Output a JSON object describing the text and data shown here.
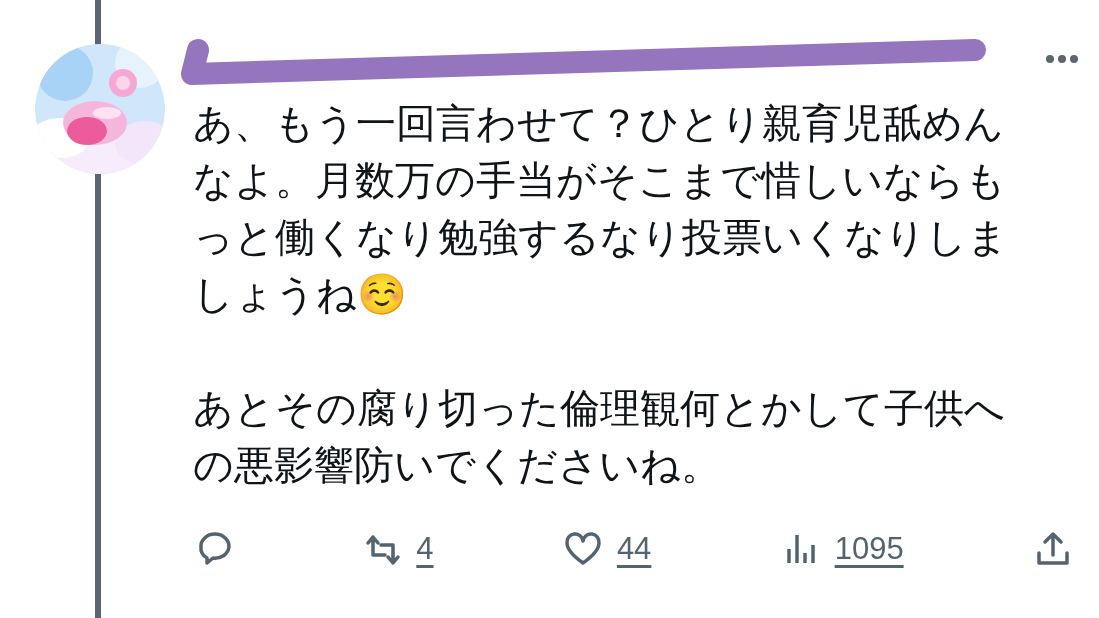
{
  "post": {
    "body": [
      "あ、もう一回言わせて？ひとり親育児舐めんなよ。月数万の手当がそこまで惜しいならもっと働くなり勉強するなり投票いくなりしましょうね☺️",
      "あとその腐り切った倫理観何とかして子供への悪影響防いでくださいね。"
    ],
    "actions": [
      {
        "kind": "reply"
      },
      {
        "kind": "repost",
        "count": "4"
      },
      {
        "kind": "like",
        "count": "44"
      },
      {
        "kind": "views",
        "count": "1095"
      },
      {
        "kind": "share"
      }
    ]
  }
}
